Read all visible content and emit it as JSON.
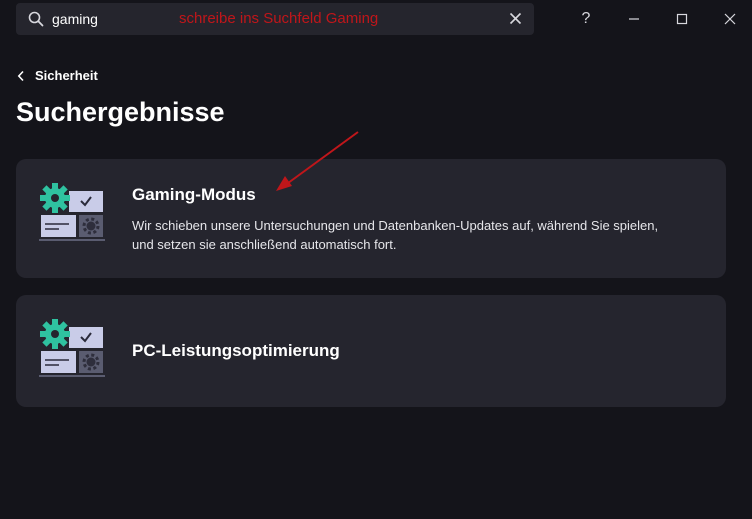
{
  "search": {
    "value": "gaming",
    "icon": "search-icon",
    "clear_icon": "close-icon"
  },
  "annotation": {
    "text": "schreibe ins Suchfeld Gaming",
    "color": "#c0161a"
  },
  "window_controls": {
    "help_label": "?",
    "icons": [
      "help-icon",
      "minimize-icon",
      "maximize-icon",
      "close-icon"
    ]
  },
  "breadcrumb": {
    "label": "Sicherheit",
    "icon": "chevron-left-icon"
  },
  "page": {
    "title": "Suchergebnisse"
  },
  "results": [
    {
      "title": "Gaming-Modus",
      "description": "Wir schieben unsere Untersuchungen und Datenbanken-Updates auf, während Sie spielen, und setzen sie anschließend automatisch fort.",
      "icon": "settings-dashboard-icon"
    },
    {
      "title": "PC-Leistungsoptimierung",
      "description": "",
      "icon": "settings-dashboard-icon"
    }
  ],
  "colors": {
    "background": "#14141a",
    "card": "#25252e",
    "accent_green": "#2fc2a0",
    "annotation_red": "#c0161a"
  }
}
